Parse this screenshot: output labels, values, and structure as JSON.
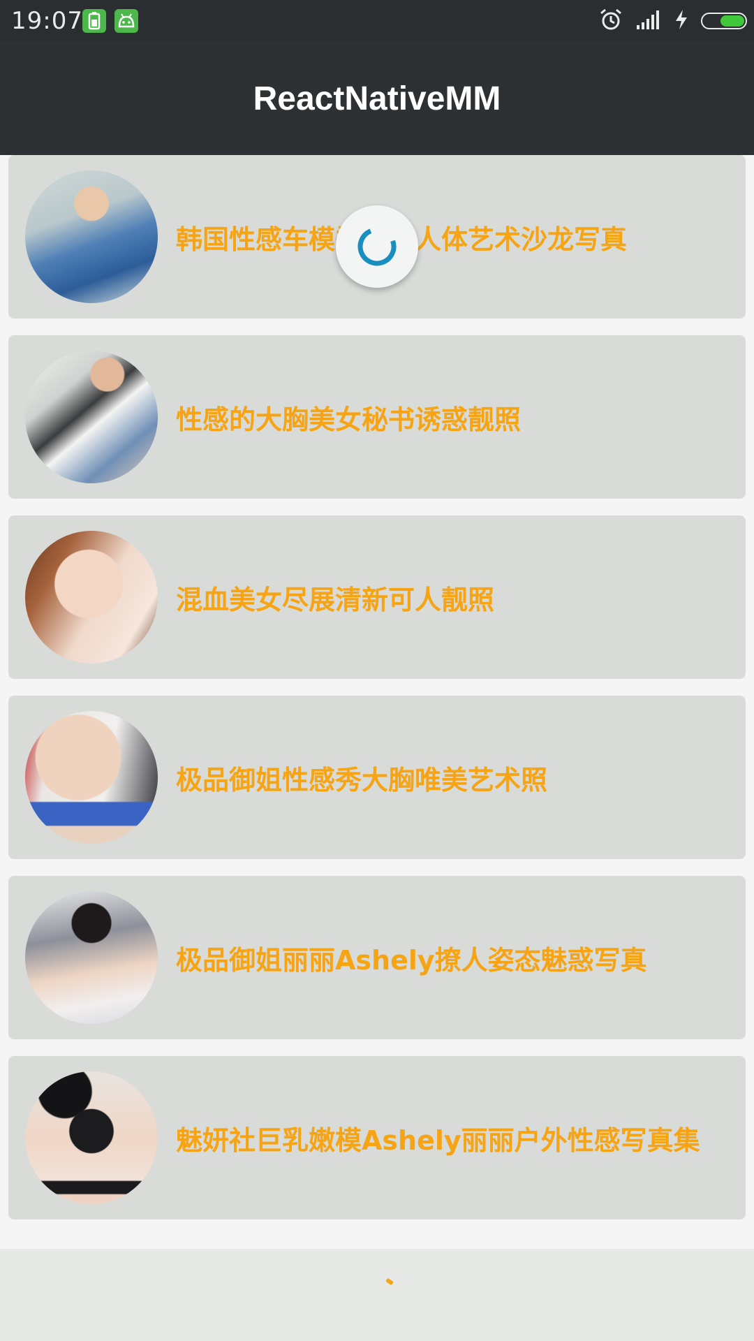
{
  "status_bar": {
    "time": "19:07",
    "icons": [
      "battery-saver-icon",
      "android-icon",
      "alarm-icon",
      "signal-icon",
      "charging-icon",
      "battery-icon"
    ],
    "battery_color": "#40c83a"
  },
  "navbar": {
    "title": "ReactNativeMM"
  },
  "list": {
    "title_color": "#f7a414",
    "items": [
      {
        "title": "韩国性感车模郑有娜人体艺术沙龙写真",
        "thumb": "photo-thumbnail"
      },
      {
        "title": "性感的大胸美女秘书诱惑靓照",
        "thumb": "photo-thumbnail"
      },
      {
        "title": "混血美女尽展清新可人靓照",
        "thumb": "photo-thumbnail"
      },
      {
        "title": "极品御姐性感秀大胸唯美艺术照",
        "thumb": "photo-thumbnail"
      },
      {
        "title": "极品御姐丽丽Ashely撩人姿态魅惑写真",
        "thumb": "photo-thumbnail"
      },
      {
        "title": "魅妍社巨乳嫩模Ashely丽丽户外性感写真集",
        "thumb": "photo-thumbnail"
      }
    ]
  },
  "refresh": {
    "state": "loading",
    "spinner_color": "#1a8fbf"
  }
}
